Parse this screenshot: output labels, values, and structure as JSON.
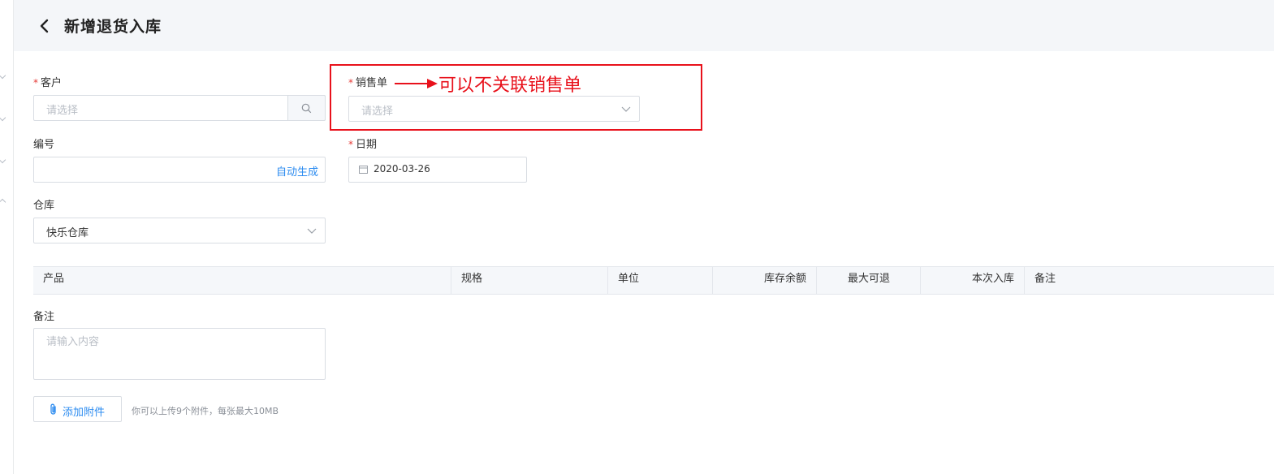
{
  "header": {
    "title": "新增退货入库",
    "back_icon": "chevron-left-icon"
  },
  "form": {
    "customer": {
      "label": "客户",
      "required_mark": "*",
      "placeholder": "请选择",
      "search_icon": "search-icon"
    },
    "sales_order": {
      "label": "销售单",
      "required_mark": "*",
      "placeholder": "请选择",
      "dropdown_icon": "chevron-down-icon"
    },
    "number": {
      "label": "编号",
      "auto_generate": "自动生成"
    },
    "date": {
      "label": "日期",
      "required_mark": "*",
      "value": "2020-03-26",
      "calendar_icon": "calendar-icon"
    },
    "warehouse": {
      "label": "仓库",
      "value": "快乐仓库",
      "dropdown_icon": "chevron-down-icon"
    }
  },
  "annotation": {
    "text": "可以不关联销售单",
    "color": "#e8111b"
  },
  "table": {
    "columns": [
      "产品",
      "规格",
      "单位",
      "库存余额",
      "最大可退",
      "本次入库",
      "备注"
    ]
  },
  "remarks": {
    "label": "备注",
    "placeholder": "请输入内容"
  },
  "attachments": {
    "button_label": "添加附件",
    "hint": "你可以上传9个附件，每张最大10MB",
    "icon": "paperclip-icon"
  },
  "colors": {
    "accent": "#2d8cf0",
    "required": "#e53935",
    "header_bg": "#f4f6f9"
  }
}
